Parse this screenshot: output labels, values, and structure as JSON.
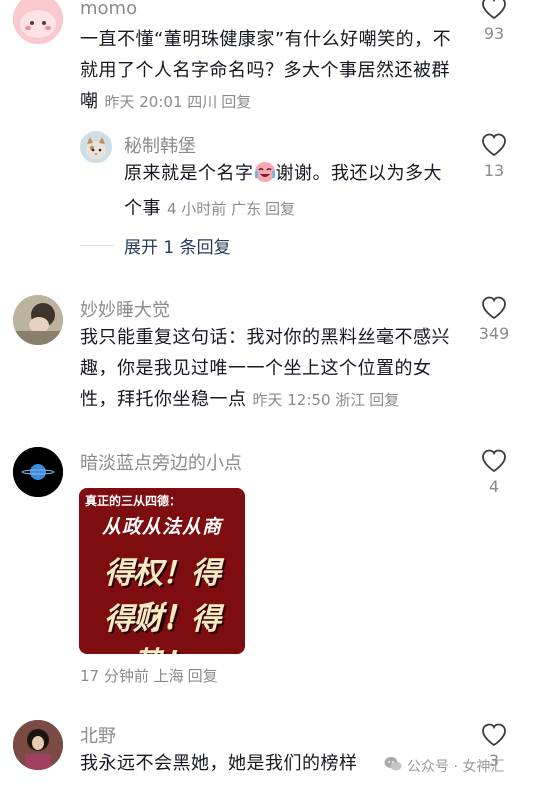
{
  "comments": [
    {
      "username": "momo",
      "text": "一直不懂“董明珠健康家”有什么好嘲笑的，不就用了个人名字命名吗？多大个事居然还被群嘲",
      "meta": "昨天 20:01 四川",
      "reply_label": "回复",
      "likes": "93"
    },
    {
      "username": "秘制韩堡",
      "text_before_emoji": "原来就是个名字",
      "text_after_emoji": "谢谢。我还以为多大个事",
      "emoji": "crying-laughing-emoji",
      "meta": "4 小时前 广东",
      "reply_label": "回复",
      "likes": "13"
    },
    {
      "username": "妙妙睡大觉",
      "text": "我只能重复这句话：我对你的黑料丝毫不感兴趣，你是我见过唯一一个坐上这个位置的女性，拜托你坐稳一点",
      "meta": "昨天 12:50 浙江",
      "reply_label": "回复",
      "likes": "349"
    },
    {
      "username": "暗淡蓝点旁边的小点",
      "sticker": {
        "line1": "真正的三从四德：",
        "line2": "从政从法从商",
        "line3": "得权！得利！",
        "line4": "得财！得势！"
      },
      "meta": "17 分钟前 上海",
      "reply_label": "回复",
      "likes": "4"
    },
    {
      "username": "北野",
      "text": "我永远不会黑她，她是我们的榜样",
      "likes": "3"
    }
  ],
  "expand_replies": "展开 1 条回复",
  "watermark": "公众号 · 女神汇",
  "colors": {
    "text": "#161823",
    "secondary": "#8a8b91",
    "expand": "#2a3a5b",
    "sticker_bg": "#7e0d10"
  }
}
